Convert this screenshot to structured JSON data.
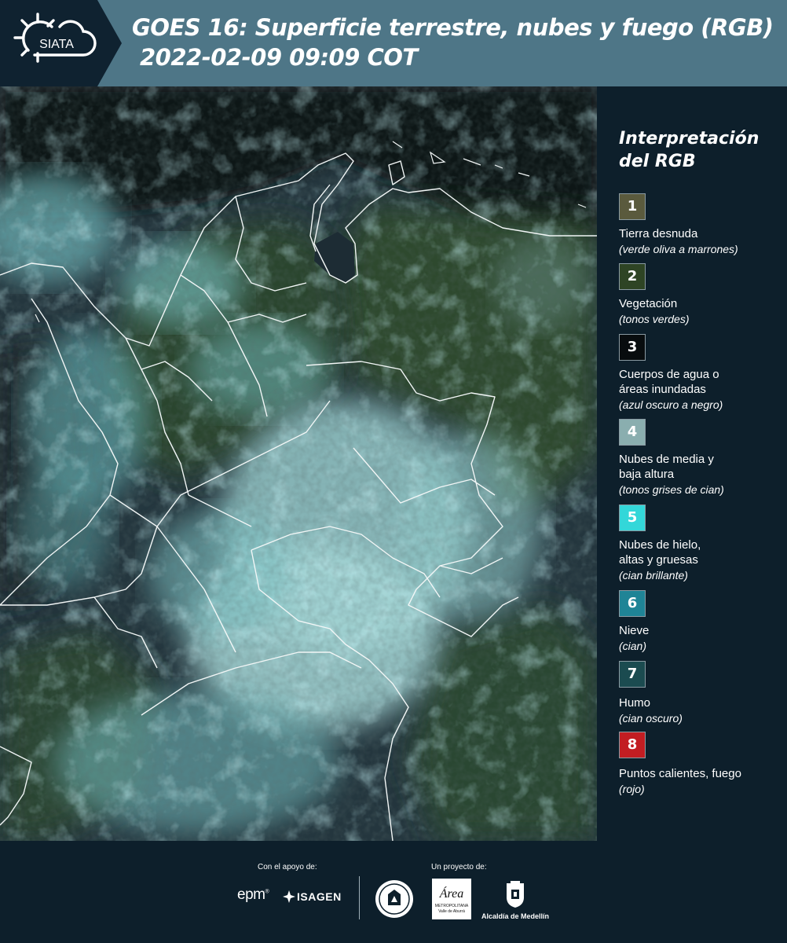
{
  "header": {
    "logo_text": "SIATA",
    "title_line1": "GOES 16: Superficie terrestre, nubes y fuego (RGB)",
    "title_line2": "2022-02-09 09:09 COT"
  },
  "legend": {
    "title": "Interpretación del RGB",
    "items": [
      {
        "num": "1",
        "label": "Tierra desnuda",
        "sub": "(verde oliva a marrones)",
        "color": "#5a5a3d"
      },
      {
        "num": "2",
        "label": "Vegetación",
        "sub": "(tonos verdes)",
        "color": "#2e4424"
      },
      {
        "num": "3",
        "label": "Cuerpos de agua o áreas inundadas",
        "sub": "(azul oscuro a negro)",
        "color": "#080c0e"
      },
      {
        "num": "4",
        "label": "Nubes de media y baja altura",
        "sub": "(tonos grises de cian)",
        "color": "#8aaeaf"
      },
      {
        "num": "5",
        "label": "Nubes de hielo, altas y gruesas",
        "sub": "(cian brillante)",
        "color": "#33d7d9"
      },
      {
        "num": "6",
        "label": "Nieve",
        "sub": "(cian)",
        "color": "#1f8496"
      },
      {
        "num": "7",
        "label": "Humo",
        "sub": "(cian oscuro)",
        "color": "#1b4b50"
      },
      {
        "num": "8",
        "label": "Puntos calientes, fuego",
        "sub": "(rojo)",
        "color": "#c21d22"
      }
    ]
  },
  "footer": {
    "support_label": "Con el apoyo de:",
    "project_label": "Un proyecto de:",
    "epm": "epm",
    "isagen": "ISAGEN",
    "area_word": "Área",
    "area_sub1": "METROPOLITANA",
    "area_sub2": "Valle de Aburrá",
    "alcaldia": "Alcaldía de Medellín"
  }
}
